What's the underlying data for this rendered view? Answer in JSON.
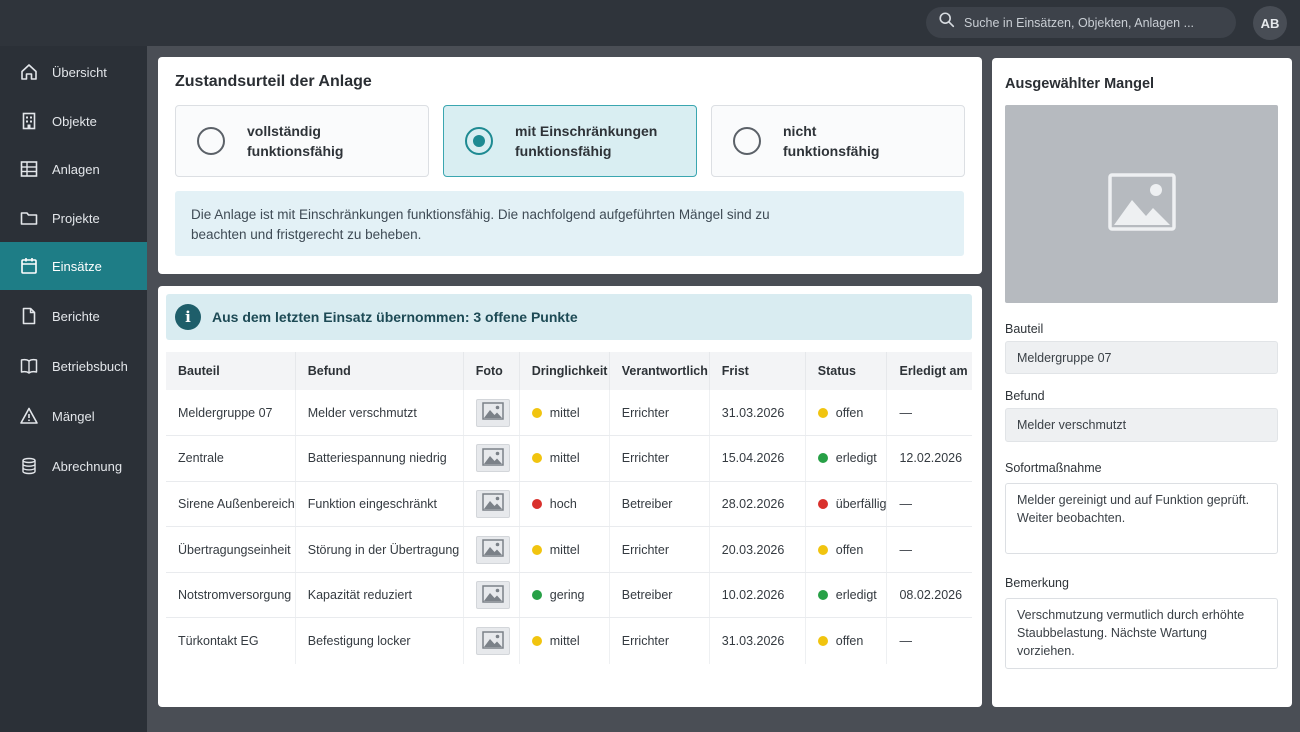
{
  "search": {
    "placeholder": "Suche in Einsätzen, Objekten, Anlagen ...",
    "icon": "search-icon"
  },
  "user": {
    "initials": "AB"
  },
  "sidebar": {
    "active_color": "#1e7d86",
    "items": [
      {
        "label": "Übersicht",
        "icon": "home-icon"
      },
      {
        "label": "Objekte",
        "icon": "building-icon"
      },
      {
        "label": "Anlagen",
        "icon": "grid-icon"
      },
      {
        "label": "Projekte",
        "icon": "folder-icon"
      },
      {
        "label": "Einsätze",
        "icon": "calendar-icon",
        "active": true
      },
      {
        "label": "Berichte",
        "icon": "document-icon"
      },
      {
        "label": "Betriebsbuch",
        "icon": "book-icon"
      },
      {
        "label": "Mängel",
        "icon": "warning-icon"
      },
      {
        "label": "Abrechnung",
        "icon": "coins-icon"
      }
    ]
  },
  "zustand": {
    "title": "Zustandsurteil der Anlage",
    "options": [
      {
        "label_line1": "vollständig",
        "label_line2": "funktionsfähig",
        "selected": false
      },
      {
        "label_line1": "mit Einschränkungen",
        "label_line2": "funktionsfähig",
        "selected": true
      },
      {
        "label_line1": "nicht",
        "label_line2": "funktionsfähig",
        "selected": false
      }
    ],
    "info_line1": "Die Anlage ist mit Einschränkungen funktionsfähig. Die nachfolgend aufgeführten Mängel sind zu",
    "info_line2": "beachten und fristgerecht zu beheben."
  },
  "maengel": {
    "banner": "Aus dem letzten Einsatz übernommen: 3 offene Punkte",
    "headers": {
      "bauteil": "Bauteil",
      "befund": "Befund",
      "foto": "Foto",
      "dringlichkeit": "Dringlichkeit",
      "verantwortlich": "Verantwortlich",
      "frist": "Frist",
      "status": "Status",
      "erledigt": "Erledigt am"
    },
    "rows": [
      {
        "bauteil": "Meldergruppe 07",
        "befund": "Melder verschmutzt",
        "dringlichkeit": "mittel",
        "dring_color": "yellow",
        "verantwortlich": "Errichter",
        "frist": "31.03.2026",
        "status": "offen",
        "status_color": "yellow",
        "erledigt": "—"
      },
      {
        "bauteil": "Zentrale",
        "befund": "Batteriespannung niedrig",
        "dringlichkeit": "mittel",
        "dring_color": "yellow",
        "verantwortlich": "Errichter",
        "frist": "15.04.2026",
        "status": "erledigt",
        "status_color": "green",
        "erledigt": "12.02.2026"
      },
      {
        "bauteil": "Sirene Außenbereich",
        "befund": "Funktion eingeschränkt",
        "dringlichkeit": "hoch",
        "dring_color": "red",
        "verantwortlich": "Betreiber",
        "frist": "28.02.2026",
        "status": "überfällig",
        "status_color": "red",
        "erledigt": "—"
      },
      {
        "bauteil": "Übertragungseinheit",
        "befund": "Störung in der Übertragung",
        "dringlichkeit": "mittel",
        "dring_color": "yellow",
        "verantwortlich": "Errichter",
        "frist": "20.03.2026",
        "status": "offen",
        "status_color": "yellow",
        "erledigt": "—"
      },
      {
        "bauteil": "Notstromversorgung",
        "befund": "Kapazität reduziert",
        "dringlichkeit": "gering",
        "dring_color": "green",
        "verantwortlich": "Betreiber",
        "frist": "10.02.2026",
        "status": "erledigt",
        "status_color": "green",
        "erledigt": "08.02.2026"
      },
      {
        "bauteil": "Türkontakt EG",
        "befund": "Befestigung locker",
        "dringlichkeit": "mittel",
        "dring_color": "yellow",
        "verantwortlich": "Errichter",
        "frist": "31.03.2026",
        "status": "offen",
        "status_color": "yellow",
        "erledigt": "—"
      }
    ]
  },
  "detail": {
    "title": "Ausgewählter Mangel",
    "bauteil_label": "Bauteil",
    "bauteil_value": "Meldergruppe 07",
    "befund_label": "Befund",
    "befund_value": "Melder verschmutzt",
    "sofort_label": "Sofortmaßnahme",
    "sofort_line1": "Melder gereinigt und auf Funktion geprüft.",
    "sofort_line2": "Weiter beobachten.",
    "bemerkung_label": "Bemerkung",
    "bemerkung_line1": "Verschmutzung vermutlich durch erhöhte",
    "bemerkung_line2": "Staubbelastung. Nächste Wartung vorziehen."
  }
}
